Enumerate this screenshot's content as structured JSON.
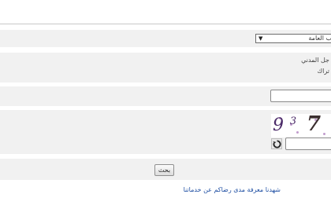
{
  "form": {
    "category_select": {
      "selected": "ب العامة",
      "arrow": "▼"
    },
    "civil_registry_label": "جل المدني",
    "subscription_label": "تراك",
    "captcha": {
      "digits": [
        "9",
        "3",
        "7"
      ]
    },
    "search_button": "بحث",
    "feedback_link": "شهدنا معرفة مدى رضاكم عن خدماتنا"
  }
}
